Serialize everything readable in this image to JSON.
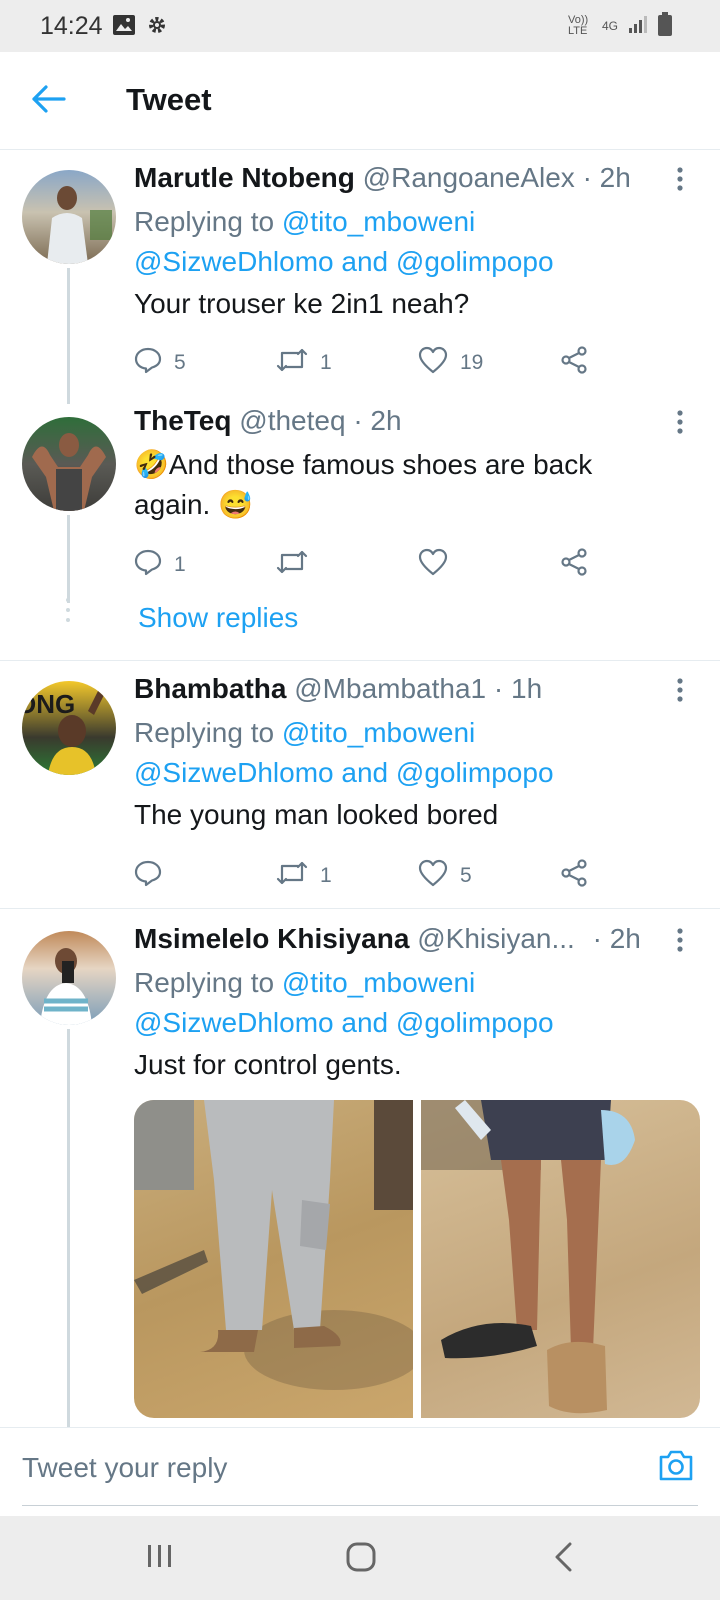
{
  "status_bar": {
    "time": "14:24",
    "network_volte": "Vo)) LTE",
    "network_4g": "4G"
  },
  "app_bar": {
    "title": "Tweet"
  },
  "colors": {
    "link": "#1da1f2",
    "secondary": "#657786",
    "divider": "#e6ecf0"
  },
  "tweets": [
    {
      "name": "Marutle Ntobeng",
      "handle": "@RangoaneAlex",
      "time": "· 2h",
      "replying_prefix": "Replying to",
      "replying_1": "@tito_mboweni",
      "replying_2": "@SizweDhlomo",
      "replying_and": "and",
      "replying_3": "@golimpopo",
      "text": "Your trouser ke 2in1 neah?",
      "replies": "5",
      "retweets": "1",
      "likes": "19"
    },
    {
      "name": "TheTeq",
      "handle": "@theteq",
      "time": "· 2h",
      "emoji_1": "🤣",
      "text_1": "And those famous shoes are back",
      "text_2": "again.",
      "emoji_2": "😅",
      "replies": "1",
      "retweets": "",
      "likes": "",
      "show_replies": "Show replies"
    },
    {
      "name": "Bhambatha",
      "handle": "@Mbambatha1",
      "time": "· 1h",
      "replying_prefix": "Replying to",
      "replying_1": "@tito_mboweni",
      "replying_2": "@SizweDhlomo",
      "replying_and": "and",
      "replying_3": "@golimpopo",
      "text": "The young man looked bored",
      "replies": "",
      "retweets": "1",
      "likes": "5"
    },
    {
      "name": "Msimelelo Khisiyana",
      "handle": "@Khisiyan...",
      "time": "· 2h",
      "replying_prefix": "Replying to",
      "replying_1": "@tito_mboweni",
      "replying_2": "@SizweDhlomo",
      "replying_and": "and",
      "replying_3": "@golimpopo",
      "text": "Just for control gents."
    }
  ],
  "reply_composer": {
    "placeholder": "Tweet your reply"
  }
}
